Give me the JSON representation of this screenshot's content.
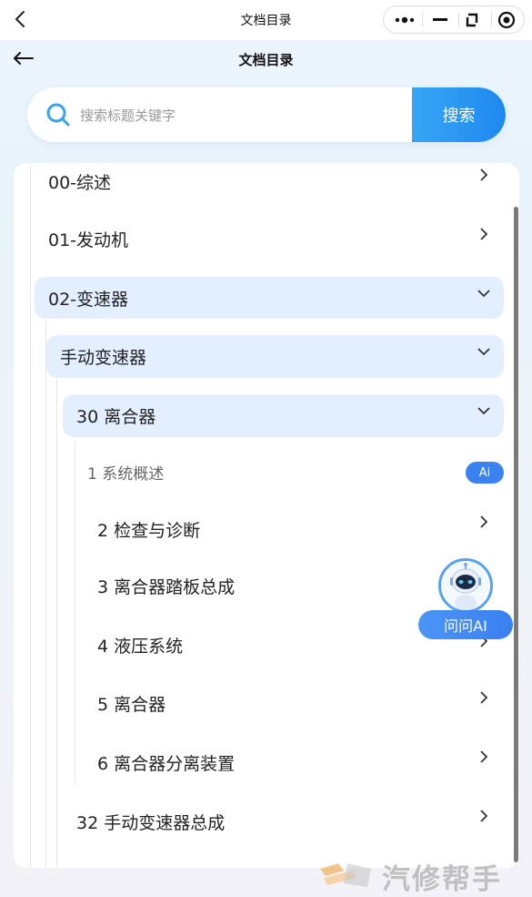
{
  "topbar": {
    "title": "文档目录"
  },
  "header": {
    "title": "文档目录"
  },
  "search": {
    "placeholder": "搜索标题关键字",
    "value": "",
    "button": "搜索"
  },
  "tree": {
    "items": [
      {
        "label": "00-综述",
        "state": "collapsed"
      },
      {
        "label": "01-发动机",
        "state": "collapsed"
      },
      {
        "label": "02-变速器",
        "state": "expanded"
      },
      {
        "label": "手动变速器",
        "state": "expanded"
      },
      {
        "label": "30 离合器",
        "state": "expanded"
      },
      {
        "label": "1 系统概述",
        "badge": "Ai"
      },
      {
        "label": "2 检查与诊断",
        "state": "collapsed"
      },
      {
        "label": "3 离合器踏板总成",
        "state": "collapsed"
      },
      {
        "label": "4 液压系统",
        "state": "collapsed"
      },
      {
        "label": "5 离合器",
        "state": "collapsed"
      },
      {
        "label": "6 离合器分离装置",
        "state": "collapsed"
      },
      {
        "label": "32 手动变速器总成",
        "state": "collapsed"
      }
    ]
  },
  "assistant": {
    "label": "问问AI"
  },
  "watermark": {
    "text": "汽修帮手"
  },
  "colors": {
    "accent": "#1e88f0",
    "highlight": "#e3efff",
    "badge": "#3b82f0"
  }
}
